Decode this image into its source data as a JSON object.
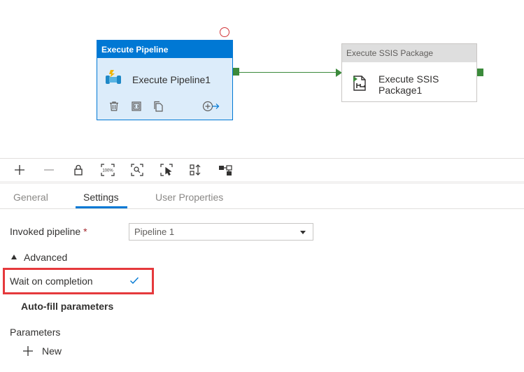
{
  "canvas": {
    "execute_pipeline": {
      "header": "Execute Pipeline",
      "name": "Execute Pipeline1",
      "icon": "pipeline-icon",
      "actions": [
        "delete-icon",
        "parameters-icon",
        "copy-icon",
        "add-output-icon"
      ]
    },
    "ssis": {
      "header": "Execute SSIS Package",
      "name": "Execute SSIS Package1",
      "icon": "ssis-package-icon"
    }
  },
  "toolbar": {
    "buttons": [
      "zoom-in-icon",
      "zoom-out-icon",
      "lock-icon",
      "zoom-100-icon",
      "zoom-to-fit-icon",
      "select-icon",
      "auto-align-icon",
      "layout-icon"
    ],
    "zoom_100_text": "100%"
  },
  "tabs": [
    {
      "label": "General",
      "active": false
    },
    {
      "label": "Settings",
      "active": true
    },
    {
      "label": "User Properties",
      "active": false
    }
  ],
  "settings": {
    "invoked_pipeline_label": "Invoked pipeline",
    "required_marker": "*",
    "invoked_pipeline_value": "Pipeline 1",
    "advanced_label": "Advanced",
    "wait_on_completion_label": "Wait on completion",
    "wait_on_completion_checked": true,
    "auto_fill_label": "Auto-fill parameters",
    "parameters_label": "Parameters",
    "new_label": "New"
  },
  "colors": {
    "accent": "#0078d4",
    "success": "#3b8a3b",
    "highlight": "#e5393c"
  }
}
